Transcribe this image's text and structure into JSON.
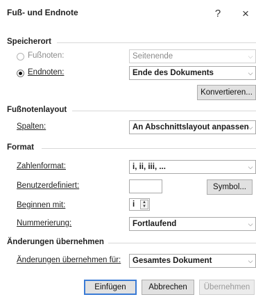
{
  "dialog": {
    "title": "Fuß- und Endnote",
    "help_glyph": "?",
    "close_glyph": "×"
  },
  "location": {
    "header": "Speicherort",
    "footnotes": {
      "label": "Fußnoten:",
      "value": "Seitenende",
      "selected": false,
      "disabled": true
    },
    "endnotes": {
      "label": "Endnoten:",
      "value": "Ende des Dokuments",
      "selected": true
    },
    "convert_label": "Konvertieren..."
  },
  "layout": {
    "header": "Fußnotenlayout",
    "columns": {
      "label": "Spalten:",
      "value": "An Abschnittslayout anpassen"
    }
  },
  "format": {
    "header": "Format",
    "number_format": {
      "label": "Zahlenformat:",
      "value": "i, ii, iii, ..."
    },
    "custom": {
      "label": "Benutzerdefiniert:",
      "value": "",
      "symbol_label": "Symbol..."
    },
    "start_at": {
      "label": "Beginnen mit:",
      "value": "i"
    },
    "numbering": {
      "label": "Nummerierung:",
      "value": "Fortlaufend"
    }
  },
  "apply": {
    "header": "Änderungen übernehmen",
    "apply_to": {
      "label": "Änderungen übernehmen für:",
      "value": "Gesamtes Dokument"
    }
  },
  "buttons": {
    "insert": "Einfügen",
    "cancel": "Abbrechen",
    "apply": "Übernehmen"
  },
  "icons": {
    "dropdown_arrow": "chevron-down-icon",
    "spin_up": "▲",
    "spin_down": "▼"
  },
  "colors": {
    "accent": "#3a7bd5",
    "border": "#a9a9a9",
    "disabled_text": "#8a8a8a"
  }
}
